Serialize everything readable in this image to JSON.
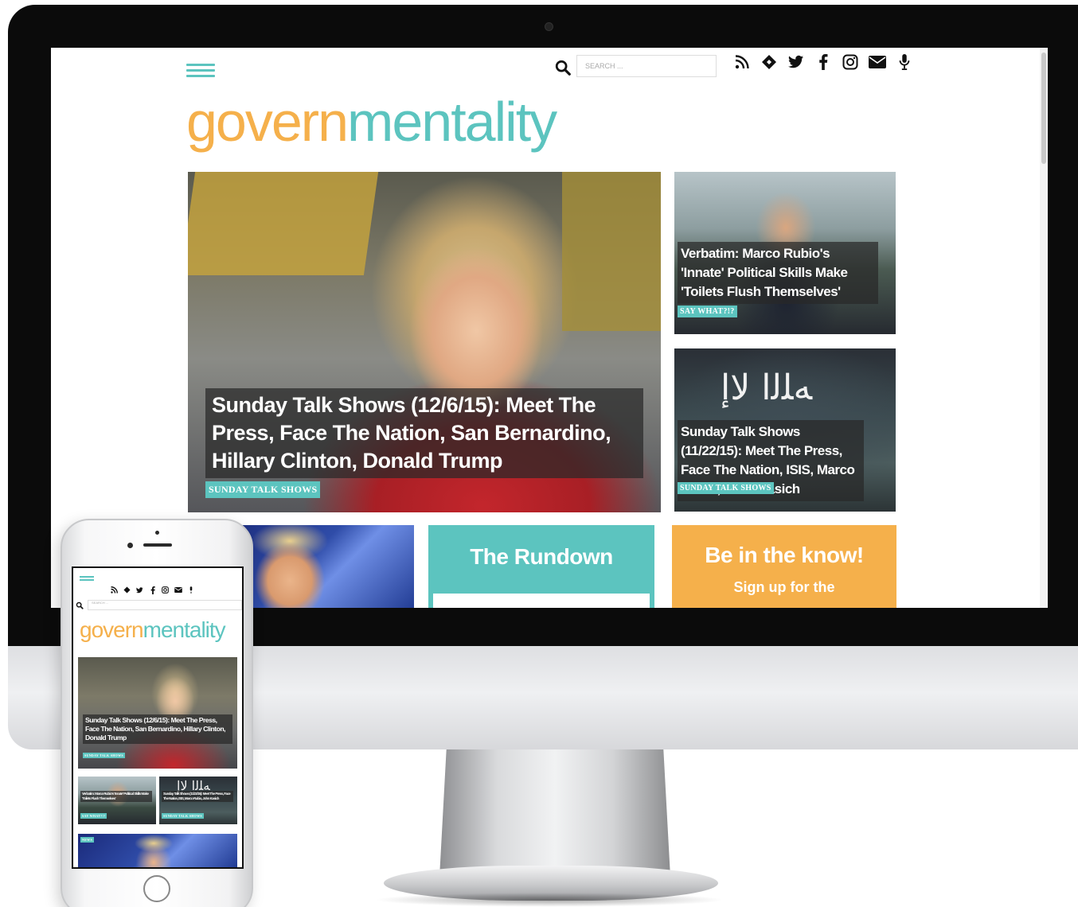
{
  "desktop": {
    "search": {
      "placeholder": "SEARCH ..."
    },
    "social_icons": [
      "rss-icon",
      "feedly-icon",
      "twitter-icon",
      "facebook-icon",
      "instagram-icon",
      "email-icon",
      "podcast-icon"
    ],
    "logo": {
      "part1": "govern",
      "part2": "mentality"
    },
    "colors": {
      "teal": "#5cc4bf",
      "orange": "#f5b04b"
    },
    "hero": {
      "headline": "Sunday Talk Shows (12/6/15): Meet The Press, Face The Nation, San Bernardino, Hillary Clinton, Donald Trump",
      "tag": "SUNDAY TALK SHOWS"
    },
    "side_cards": [
      {
        "headline": "Verbatim: Marco Rubio's 'Innate' Political Skills Make 'Toilets Flush Themselves'",
        "tag": "SAY WHAT?!?"
      },
      {
        "headline": "Sunday Talk Shows (11/22/15): Meet The Press, Face The Nation, ISIS, Marco Rubio, John Kasich",
        "tag": "SUNDAY TALK SHOWS"
      }
    ],
    "rundown": {
      "title": "The Rundown"
    },
    "signup": {
      "title": "Be in the know!",
      "subtitle": "Sign up for the"
    }
  },
  "mobile": {
    "search": {
      "placeholder": "SEARCH ..."
    },
    "logo": {
      "part1": "govern",
      "part2": "mentality"
    },
    "hero": {
      "headline": "Sunday Talk Shows (12/6/15): Meet The Press, Face The Nation, San Bernardino, Hillary Clinton, Donald Trump",
      "tag": "SUNDAY TALK SHOWS"
    },
    "cards": [
      {
        "headline": "Verbatim: Marco Rubio's 'Innate' Political Skills Make 'Toilets Flush Themselves'",
        "tag": "SAY WHAT?!?"
      },
      {
        "headline": "Sunday Talk Shows (11/22/15): Meet The Press, Face The Nation, ISIS, Marco Rubio, John Kasich",
        "tag": "SUNDAY TALK SHOWS"
      }
    ],
    "trump_tag": "NEWS"
  }
}
